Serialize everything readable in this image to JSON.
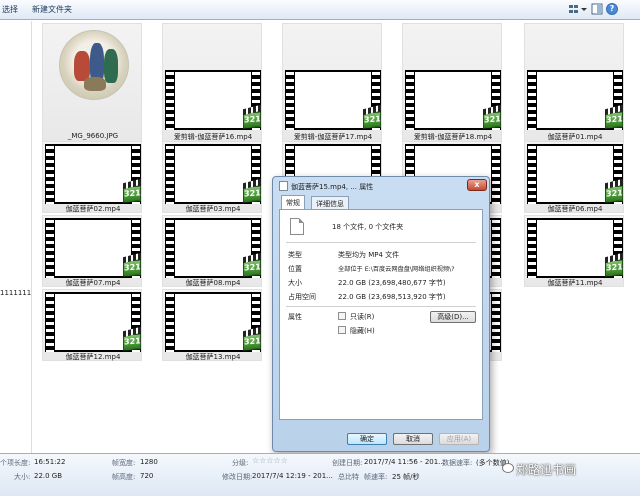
{
  "toolbar": {
    "select_label": "选择",
    "new_folder_label": "新建文件夹",
    "view_icon": "view-options-icon",
    "preview_icon": "preview-pane-icon",
    "help_icon": "help-icon",
    "help_glyph": "?"
  },
  "nav": {
    "partial_text": "1111111"
  },
  "files": [
    {
      "name": "_MG_9660.JPG",
      "type": "image"
    },
    {
      "name": "爱剪辑-伽蓝菩萨16.mp4",
      "type": "video"
    },
    {
      "name": "爱剪辑-伽蓝菩萨17.mp4",
      "type": "video"
    },
    {
      "name": "爱剪辑-伽蓝菩萨18.mp4",
      "type": "video"
    },
    {
      "name": "伽蓝菩萨01.mp4",
      "type": "video"
    },
    {
      "name": "伽蓝菩萨02.mp4",
      "type": "video"
    },
    {
      "name": "伽蓝菩萨03.mp4",
      "type": "video"
    },
    {
      "name": "伽蓝菩萨06.mp4",
      "type": "video"
    },
    {
      "name": "伽蓝菩萨07.mp4",
      "type": "video"
    },
    {
      "name": "伽蓝菩萨08.mp4",
      "type": "video"
    },
    {
      "name": "伽蓝菩萨11.mp4",
      "type": "video"
    },
    {
      "name": "伽蓝菩萨12.mp4",
      "type": "video"
    },
    {
      "name": "伽蓝菩萨13.mp4",
      "type": "video"
    }
  ],
  "badge_text": "321",
  "dialog": {
    "title": "伽蓝菩萨15.mp4, ... 属性",
    "close_glyph": "x",
    "tabs": [
      "常规",
      "详细信息"
    ],
    "summary": "18 个文件, 0 个文件夹",
    "rows": [
      {
        "label": "类型",
        "value": "类型均为 MP4 文件"
      },
      {
        "label": "位置",
        "value": "全部位于 E:\\百度云网盘盘\\网络组织视频\\?"
      },
      {
        "label": "大小",
        "value": "22.0 GB (23,698,480,677 字节)"
      },
      {
        "label": "占用空间",
        "value": "22.0 GB (23,698,513,920 字节)"
      }
    ],
    "attributes_label": "属性",
    "readonly_label": "只读(R)",
    "hidden_label": "隐藏(H)",
    "advanced_label": "高级(D)...",
    "ok_label": "确定",
    "cancel_label": "取消",
    "apply_label": "应用(A)"
  },
  "details": {
    "selected_partial": "个项",
    "length_label": "长度:",
    "length_value": "16:51:22",
    "size_label": "大小:",
    "size_value": "22.0 GB",
    "frame_width_label": "帧宽度:",
    "frame_width_value": "1280",
    "frame_height_label": "帧高度:",
    "frame_height_value": "720",
    "rating_label": "分级:",
    "rating_value": 0,
    "rating_max": 5,
    "modified_label": "修改日期:",
    "modified_value": "2017/7/4 12:19 - 201...",
    "created_label": "创建日期:",
    "created_value": "2017/7/4 11:56 - 201...",
    "data_rate_label": "数据速率:",
    "data_rate_value": "(多个数值)",
    "frame_rate_label": "帧速率:",
    "frame_rate_value": "25 帧/秒",
    "total_bitrate_partial": "总比特"
  },
  "watermark": {
    "text": "郑路迅书画"
  },
  "colors": {
    "accent": "#3c7fb1",
    "close_red": "#c44a31",
    "badge_green": "#2c7a1c"
  }
}
